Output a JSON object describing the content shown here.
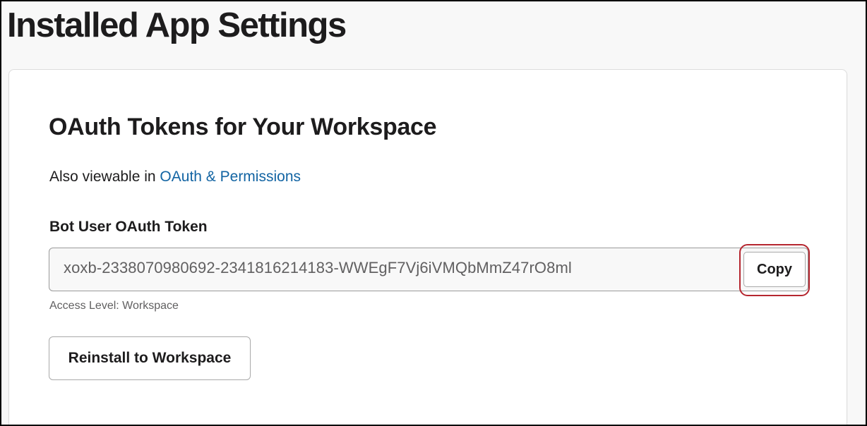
{
  "page": {
    "title": "Installed App Settings"
  },
  "section": {
    "title": "OAuth Tokens for Your Workspace",
    "subtitle_prefix": "Also viewable in ",
    "subtitle_link": "OAuth & Permissions"
  },
  "token": {
    "label": "Bot User OAuth Token",
    "value": "xoxb-2338070980692-2341816214183-WWEgF7Vj6iVMQbMmZ47rO8ml",
    "copy_label": "Copy",
    "access_level": "Access Level: Workspace"
  },
  "actions": {
    "reinstall_label": "Reinstall to Workspace"
  },
  "colors": {
    "link": "#1264a3",
    "highlight": "#b5262f",
    "text": "#1d1c1d",
    "muted": "#616061"
  }
}
